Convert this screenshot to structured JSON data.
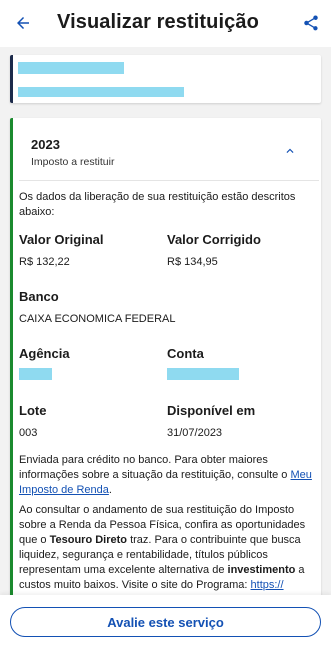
{
  "header": {
    "title": "Visualizar restituição"
  },
  "icons": {
    "back": "arrow-left-icon",
    "share": "share-icon",
    "collapse": "chevron-up-icon"
  },
  "colors": {
    "primary": "#1351b4",
    "success_bar": "#1b8a2e",
    "info_bar": "#1c2a4a",
    "redaction": "#8fdaf0"
  },
  "card": {
    "year": "2023",
    "subtitle": "Imposto a restituir",
    "intro": "Os dados da liberação de sua restituição estão descritos abaixo:",
    "valor_original_label": "Valor Original",
    "valor_original": "R$ 132,22",
    "valor_corrigido_label": "Valor Corrigido",
    "valor_corrigido": "R$ 134,95",
    "banco_label": "Banco",
    "banco": "CAIXA ECONOMICA FEDERAL",
    "agencia_label": "Agência",
    "conta_label": "Conta",
    "lote_label": "Lote",
    "lote": "003",
    "disponivel_label": "Disponível em",
    "disponivel": "31/07/2023",
    "p1_text": "Enviada para crédito no banco. Para obter maiores informações sobre a situação da restituição, consulte o",
    "p1_link": "Meu Imposto de Renda",
    "p1_end": ".",
    "p2_a": "Ao consultar o andamento de sua restituição do Imposto sobre a Renda da Pessoa Física, confira as oportunidades que o ",
    "p2_b": "Tesouro Direto",
    "p2_c": " traz.  Para o contribuinte que busca liquidez, segurança e rentabilidade, títulos públicos representam uma excelente alternativa de ",
    "p2_d": "investimento",
    "p2_e": " a custos muito baixos. Visite o site do Programa: ",
    "p2_link": "https://"
  },
  "footer": {
    "button_label": "Avalie este serviço"
  }
}
